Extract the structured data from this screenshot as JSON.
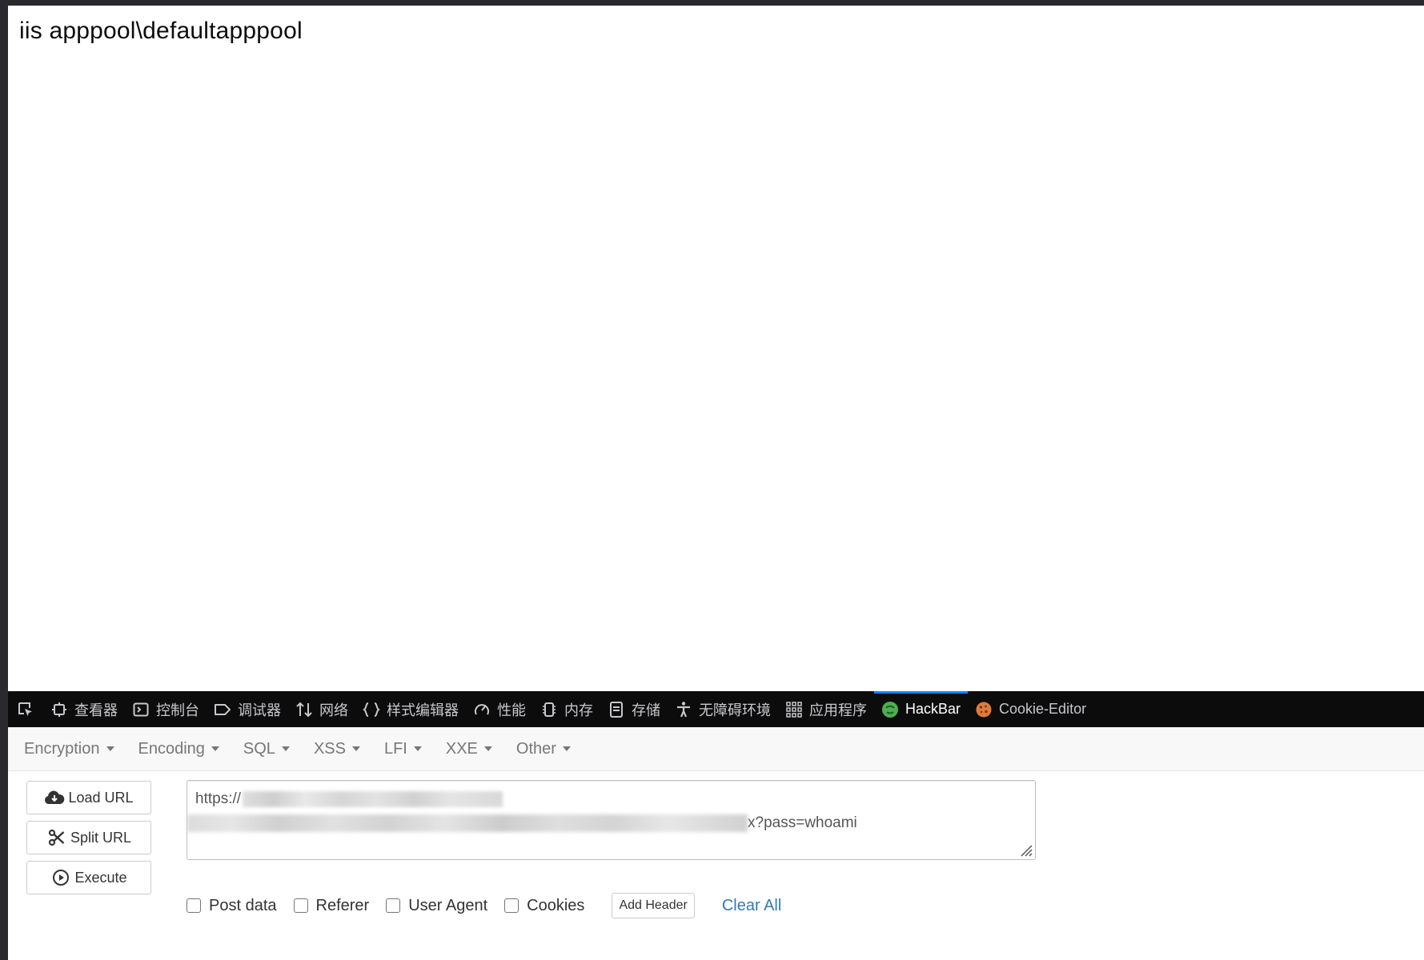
{
  "page": {
    "output_text": "iis apppool\\defaultapppool"
  },
  "devtools": {
    "tabs": [
      {
        "label": "查看器",
        "icon": "inspector-icon"
      },
      {
        "label": "控制台",
        "icon": "console-icon"
      },
      {
        "label": "调试器",
        "icon": "debugger-icon"
      },
      {
        "label": "网络",
        "icon": "network-icon"
      },
      {
        "label": "样式编辑器",
        "icon": "style-editor-icon"
      },
      {
        "label": "性能",
        "icon": "performance-icon"
      },
      {
        "label": "内存",
        "icon": "memory-icon"
      },
      {
        "label": "存储",
        "icon": "storage-icon"
      },
      {
        "label": "无障碍环境",
        "icon": "accessibility-icon"
      },
      {
        "label": "应用程序",
        "icon": "application-icon"
      },
      {
        "label": "HackBar",
        "icon": "hackbar-icon",
        "active": true
      },
      {
        "label": "Cookie-Editor",
        "icon": "cookie-icon"
      }
    ],
    "active_tab": "HackBar",
    "accent_color": "#0a84ff"
  },
  "hackbar": {
    "menu": [
      "Encryption",
      "Encoding",
      "SQL",
      "XSS",
      "LFI",
      "XXE",
      "Other"
    ],
    "buttons": {
      "load_url": "Load URL",
      "split_url": "Split URL",
      "execute": "Execute"
    },
    "url": {
      "prefix": "https://",
      "suffix": "x?pass=whoami"
    },
    "options": {
      "post_data": "Post data",
      "referer": "Referer",
      "user_agent": "User Agent",
      "cookies": "Cookies",
      "add_header": "Add Header",
      "clear_all": "Clear All"
    }
  }
}
